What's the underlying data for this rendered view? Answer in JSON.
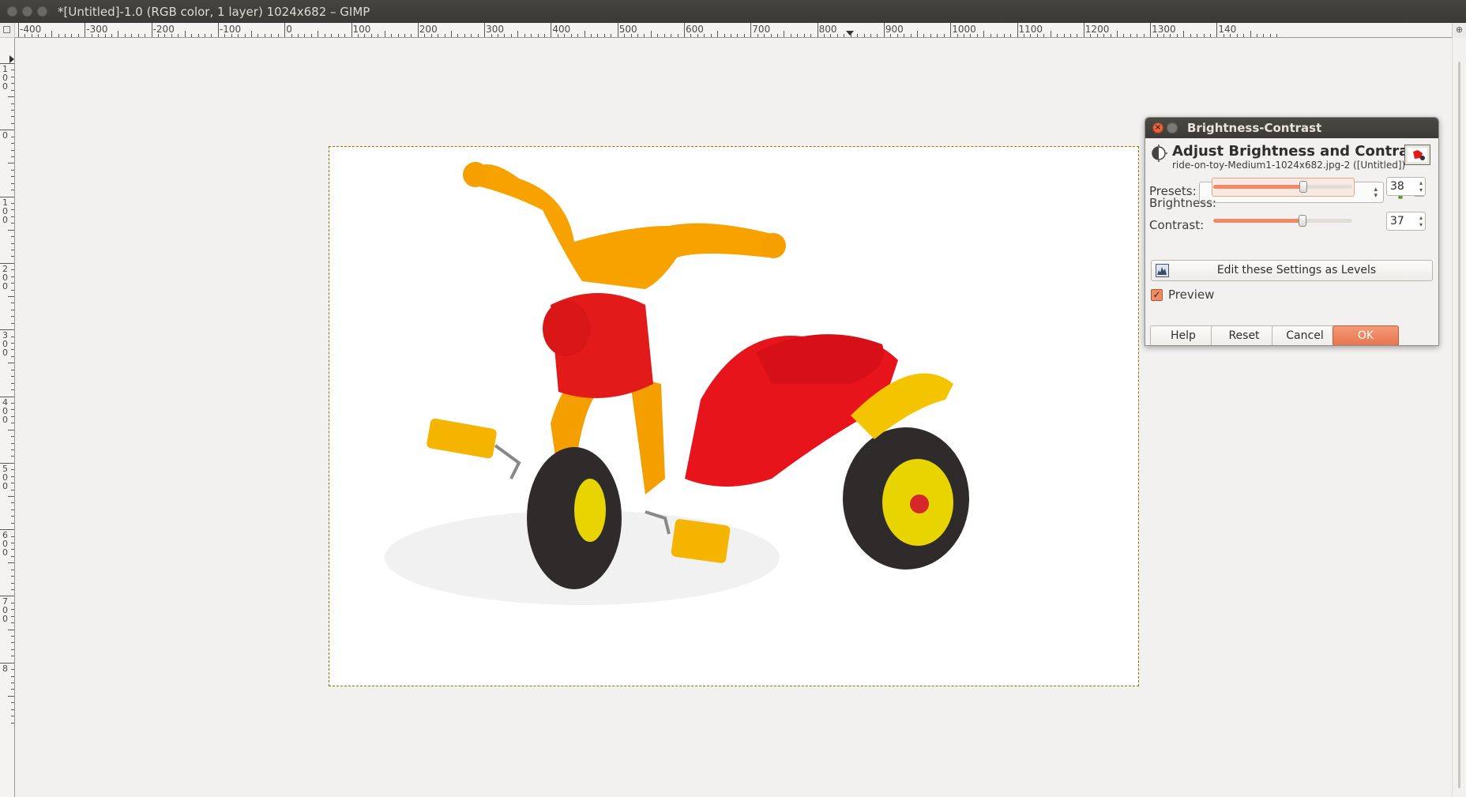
{
  "window": {
    "title": "*[Untitled]-1.0 (RGB color, 1 layer) 1024x682 – GIMP"
  },
  "ruler": {
    "h_labels": [
      "-400",
      "-300",
      "-200",
      "-100",
      "0",
      "100",
      "200",
      "300",
      "400",
      "500",
      "600",
      "700",
      "800",
      "900",
      "1000",
      "1100",
      "1200",
      "1300",
      "140"
    ],
    "v_labels": [
      "100",
      "0",
      "100",
      "200",
      "300",
      "400",
      "500",
      "600",
      "700",
      "8"
    ]
  },
  "canvas": {
    "image_description": "red and yellow ride-on toy tricycle"
  },
  "dialog": {
    "title": "Brightness-Contrast",
    "header_title": "Adjust Brightness and Contrast",
    "header_subtitle": "ride-on-toy-Medium1-1024x682.jpg-2 ([Untitled])",
    "presets_label": "Presets:",
    "presets_value": "",
    "brightness_label": "Brightness:",
    "brightness_value": "38",
    "contrast_label": "Contrast:",
    "contrast_value": "37",
    "levels_button": "Edit these Settings as Levels",
    "preview_label": "Preview",
    "preview_checked": true,
    "buttons": {
      "help": "Help",
      "reset": "Reset",
      "cancel": "Cancel",
      "ok": "OK"
    }
  },
  "colors": {
    "accent": "#f08a64",
    "titlebar": "#3c3b37"
  }
}
